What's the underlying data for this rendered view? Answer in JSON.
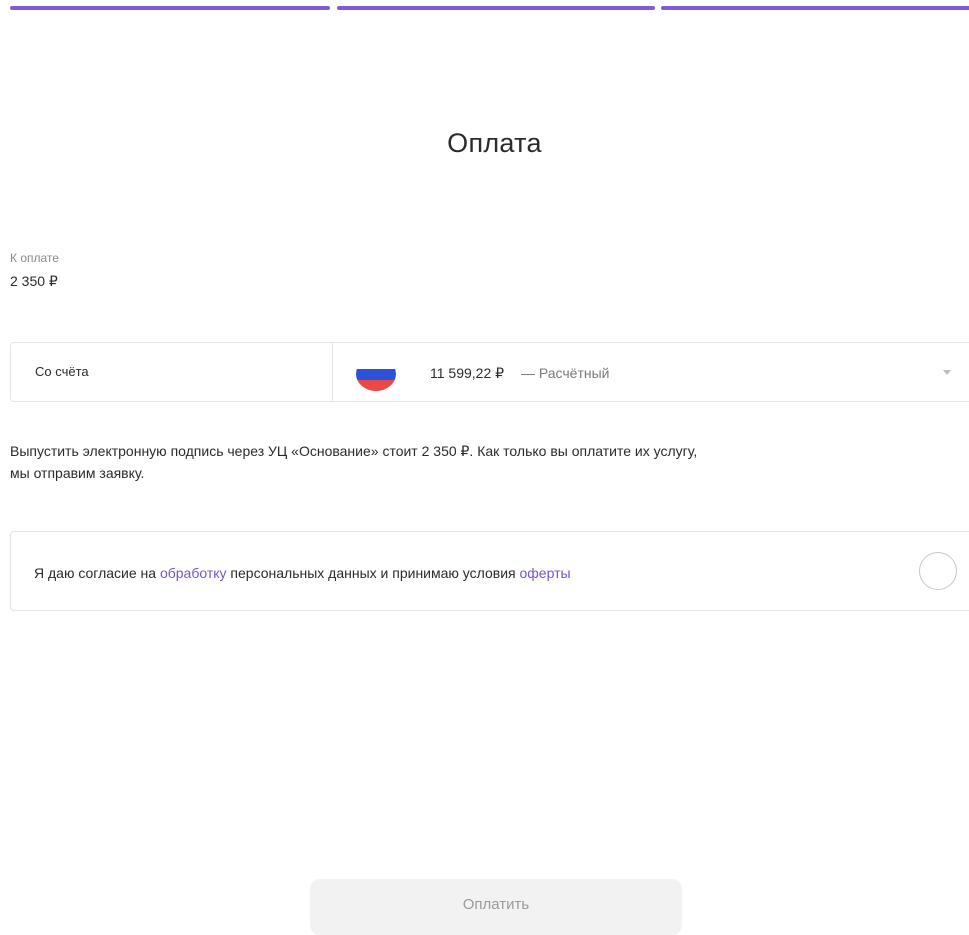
{
  "progress": {
    "steps_total": 3,
    "steps_completed": 3,
    "color": "#7f5bd6"
  },
  "page": {
    "title": "Оплата"
  },
  "amount": {
    "label": "К оплате",
    "value": "2 350 ₽"
  },
  "account": {
    "label": "Со счёта",
    "balance": "11 599,22 ₽",
    "type": "— Расчётный",
    "flag_icon": "russia-flag-icon",
    "dropdown_icon": "chevron-down-icon"
  },
  "description": {
    "line1": "Выпустить электронную подпись через УЦ «Основание» стоит 2 350 ₽. Как только вы оплатите их услугу,",
    "line2": "мы отправим заявку."
  },
  "consent": {
    "text_part1": "Я даю согласие на ",
    "link_processing": "обработку",
    "text_part2": " персональных данных и принимаю условия ",
    "link_offer": "оферты",
    "link_color": "#7a52c9",
    "checked": false
  },
  "actions": {
    "pay_label": "Оплатить",
    "pay_disabled": true
  }
}
